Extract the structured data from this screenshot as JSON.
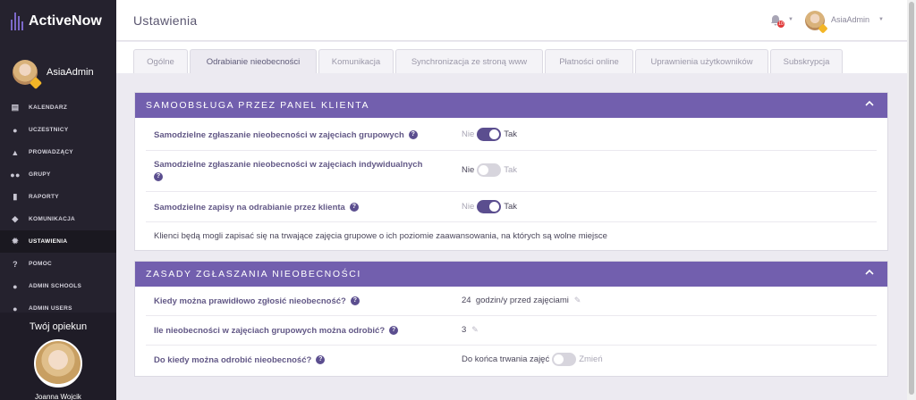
{
  "app": {
    "name": "ActiveNow"
  },
  "user": {
    "name": "AsiaAdmin"
  },
  "sidebar": {
    "items": [
      {
        "label": "KALENDARZ",
        "icon": "calendar-icon"
      },
      {
        "label": "UCZESTNICY",
        "icon": "user-icon"
      },
      {
        "label": "PROWADZĄCY",
        "icon": "graduation-cap-icon"
      },
      {
        "label": "GRUPY",
        "icon": "users-icon"
      },
      {
        "label": "RAPORTY",
        "icon": "bar-chart-icon"
      },
      {
        "label": "KOMUNIKACJA",
        "icon": "chat-icon"
      },
      {
        "label": "USTAWIENIA",
        "icon": "gear-icon",
        "active": true
      },
      {
        "label": "POMOC",
        "icon": "help-icon"
      },
      {
        "label": "ADMIN SCHOOLS",
        "icon": "user-icon"
      },
      {
        "label": "ADMIN USERS",
        "icon": "user-icon"
      }
    ],
    "caretaker_title": "Twój opiekun",
    "caretaker_name": "Joanna Wojcik"
  },
  "header": {
    "title": "Ustawienia",
    "notifications_count": "10",
    "user_name": "AsiaAdmin"
  },
  "tabs": [
    {
      "label": "Ogólne"
    },
    {
      "label": "Odrabianie nieobecności",
      "active": true
    },
    {
      "label": "Komunikacja"
    },
    {
      "label": "Synchronizacja ze stroną www"
    },
    {
      "label": "Płatności online"
    },
    {
      "label": "Uprawnienia użytkowników"
    },
    {
      "label": "Subskrypcja"
    }
  ],
  "panel_self_service": {
    "title": "SAMOOBSŁUGA PRZEZ PANEL KLIENTA",
    "rows": [
      {
        "label": "Samodzielne zgłaszanie nieobecności w zajęciach grupowych",
        "off_label": "Nie",
        "on_label": "Tak",
        "enabled": true
      },
      {
        "label": "Samodzielne zgłaszanie nieobecności w zajęciach indywidualnych",
        "off_label": "Nie",
        "on_label": "Tak",
        "enabled": false
      },
      {
        "label": "Samodzielne zapisy na odrabianie przez klienta",
        "off_label": "Nie",
        "on_label": "Tak",
        "enabled": true
      }
    ],
    "note": "Klienci będą mogli zapisać się na trwające zajęcia grupowe o ich poziomie zaawansowania, na których są wolne miejsce"
  },
  "panel_rules": {
    "title": "ZASADY ZGŁASZANIA NIEOBECNOŚCI",
    "rows": [
      {
        "label": "Kiedy można prawidłowo zgłosić nieobecność?",
        "value": "24  godzin/y przed zajęciami"
      },
      {
        "label": "Ile nieobecności w zajęciach grupowych można odrobić?",
        "value": "3"
      },
      {
        "label": "Do kiedy można odrobić nieobecność?",
        "value": "Do końca trwania zajęć",
        "toggle_label": "Zmień",
        "enabled": false
      }
    ]
  },
  "colors": {
    "accent": "#725fae",
    "sidebar": "#25222e",
    "toggle_on": "#5b4e8f"
  }
}
